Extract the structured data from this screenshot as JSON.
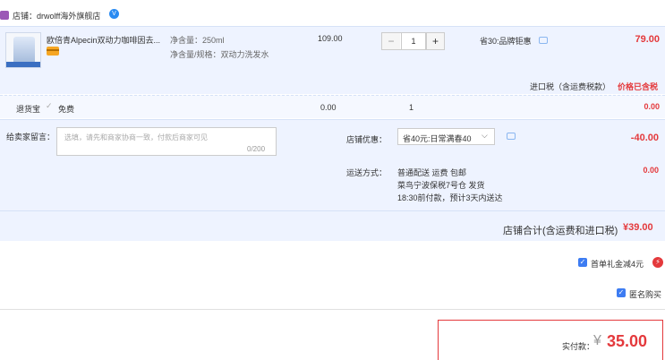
{
  "store": {
    "label": "店铺：drwolff海外旗舰店",
    "verify_icon": "V"
  },
  "item": {
    "title": "欧倍青Alpecin双动力咖啡因去...",
    "sku_line1": "净含量：250ml",
    "sku_line2": "净含量/规格：双动力洗发水",
    "unit_price": "109.00",
    "qty": "1",
    "qty_minus": "−",
    "qty_plus": "+",
    "discount": "省30:品牌钜惠",
    "total": "79.00",
    "tax_label": "进口税（含运费税款）",
    "tax_value": "价格已含税"
  },
  "return_insurance": {
    "label": "退货宝",
    "check": "✓",
    "option": "免费",
    "price": "0.00",
    "qty": "1",
    "total": "0.00"
  },
  "options": {
    "note_label": "给卖家留言：",
    "note_placeholder": "选填，请先和商家协商一致，付款后商家可见",
    "note_count": "0/200",
    "promo_label": "店铺优惠：",
    "promo_selected": "省40元:日常满春40",
    "promo_caret": "⌵",
    "promo_value": "-40.00",
    "ship_label": "运送方式：",
    "ship_line1": "普通配送 运费 包邮",
    "ship_line2": "菜鸟宁波保税7号仓  发货",
    "ship_line3": "18:30前付款，预计3天内送达",
    "ship_value": "0.00",
    "store_total_label": "店铺合计(含运费和进口税)",
    "store_total_value": "¥39.00"
  },
  "gift": {
    "label": "首单礼金减4元",
    "check": "✓",
    "bolt": "⚡"
  },
  "anonymous": {
    "label": "匿名购买",
    "check": "✓"
  },
  "payment": {
    "label": "实付款：",
    "symbol": "¥",
    "value": "35.00"
  },
  "colors": {
    "accent": "#e4393c",
    "blue": "#3d7cf2",
    "panel": "#eef3ff"
  }
}
